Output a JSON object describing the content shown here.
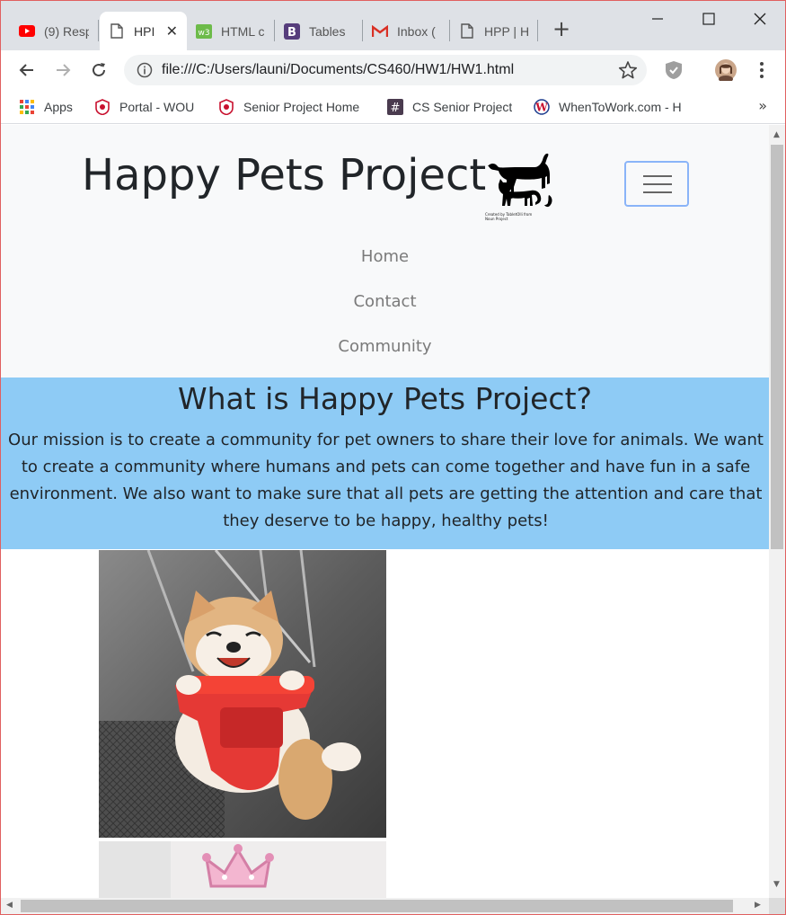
{
  "tabs": [
    {
      "title": "(9) Resp",
      "favicon": "youtube-icon"
    },
    {
      "title": "HPI",
      "favicon": "page-icon",
      "active": true
    },
    {
      "title": "HTML c",
      "favicon": "w3-icon"
    },
    {
      "title": "Tables",
      "favicon": "bootstrap-icon"
    },
    {
      "title": "Inbox (",
      "favicon": "gmail-icon"
    },
    {
      "title": "HPP | H",
      "favicon": "page-icon"
    }
  ],
  "toolbar": {
    "url": "file:///C:/Users/launi/Documents/CS460/HW1/HW1.html"
  },
  "bookmarks": [
    {
      "label": "Apps",
      "icon": "apps-grid-icon"
    },
    {
      "label": "Portal - WOU",
      "icon": "wou-shield-icon"
    },
    {
      "label": "Senior Project Home",
      "icon": "wou-shield-icon"
    },
    {
      "label": "CS Senior Project",
      "icon": "hash-icon"
    },
    {
      "label": "WhenToWork.com - H",
      "icon": "whentowork-icon"
    }
  ],
  "page": {
    "brand": "Happy Pets Project",
    "logo_caption": "Created by TabletOlli from Noun Project",
    "nav": [
      "Home",
      "Contact",
      "Community"
    ],
    "hero_title": "What is Happy Pets Project?",
    "hero_text": "Our mission is to create a community for pet owners to share their love for animals. We want to create a community where humans and pets can come together and have fun in a safe environment. We also want to make sure that all pets are getting the attention and care that they deserve to be happy, healthy pets!"
  },
  "colors": {
    "hero_bg": "#8ecbf5",
    "navbar_bg": "#f8f9fa",
    "toggler_border": "#8ab4f8"
  }
}
